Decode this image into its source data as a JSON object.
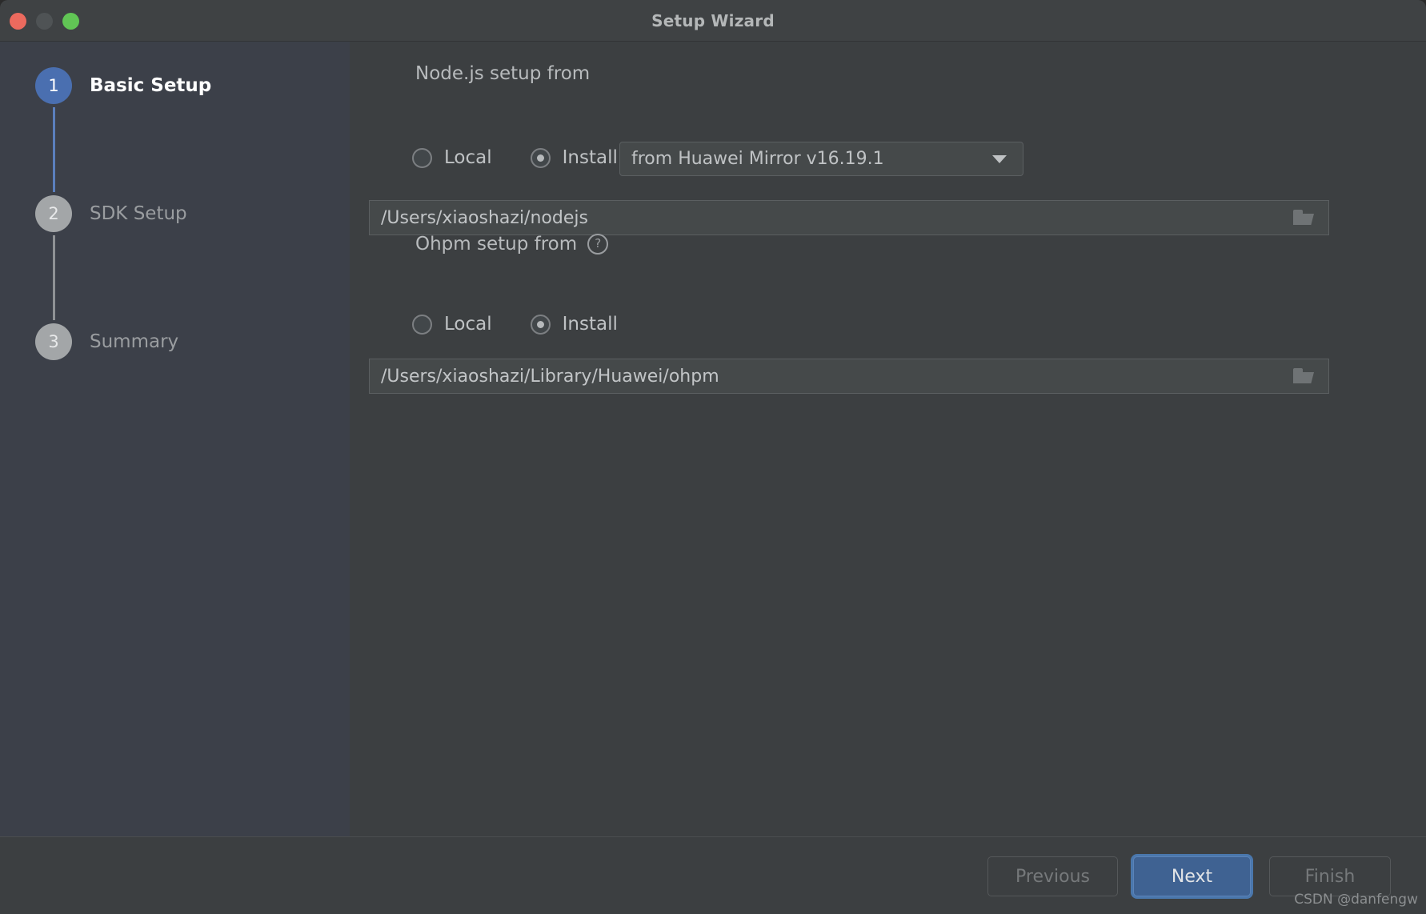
{
  "window": {
    "title": "Setup Wizard",
    "traffic_lights": [
      "close",
      "minimize",
      "zoom"
    ]
  },
  "sidebar": {
    "steps": [
      {
        "number": "1",
        "label": "Basic Setup",
        "state": "active"
      },
      {
        "number": "2",
        "label": "SDK Setup",
        "state": "inactive"
      },
      {
        "number": "3",
        "label": "Summary",
        "state": "inactive"
      }
    ]
  },
  "main": {
    "nodejs": {
      "section_label": "Node.js setup from",
      "radios": [
        {
          "label": "Local",
          "checked": false
        },
        {
          "label": "Install",
          "checked": true
        }
      ],
      "version_select": {
        "value": "from Huawei Mirror v16.19.1"
      },
      "path": {
        "value": "/Users/xiaoshazi/nodejs",
        "browse_icon": "folder-icon"
      }
    },
    "ohpm": {
      "section_label": "Ohpm setup from",
      "help_icon": "?",
      "radios": [
        {
          "label": "Local",
          "checked": false
        },
        {
          "label": "Install",
          "checked": true
        }
      ],
      "path": {
        "value": "/Users/xiaoshazi/Library/Huawei/ohpm",
        "browse_icon": "folder-icon"
      }
    }
  },
  "footer": {
    "previous_label": "Previous",
    "next_label": "Next",
    "finish_label": "Finish",
    "watermark": "CSDN @danfengw"
  },
  "colors": {
    "accent_blue": "#4a6fb0",
    "button_blue": "#3f6292",
    "sidebar_bg": "#3c4049",
    "content_bg": "#3c3f41",
    "close_red": "#ec6a5e",
    "zoom_green": "#61c555",
    "disabled_text": "#76797b"
  }
}
